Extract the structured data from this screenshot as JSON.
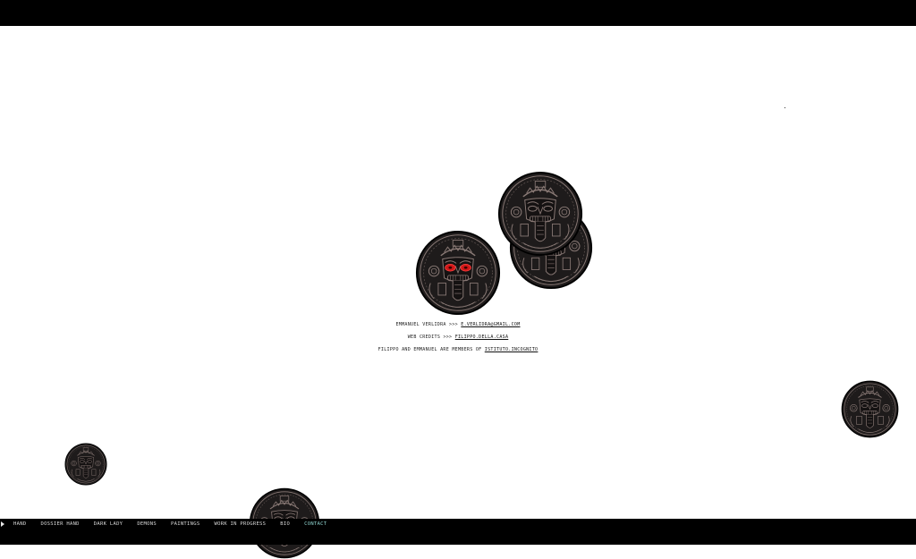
{
  "nav": {
    "items": [
      "HAND",
      "DOSSIER HAND",
      "DARK LADY",
      "DEMONS",
      "PAINTINGS",
      "WORK IN PROGRESS",
      "BIO",
      "CONTACT"
    ],
    "active": "CONTACT"
  },
  "contact": {
    "line1_label": "EMMANUEL VERLIDRA >>>",
    "line1_link": "E.VERLIDRA@GMAIL.COM",
    "line2_label": "WEB CREDITS >>>",
    "line2_link": "FILIPPO.DELLA.CASA",
    "line3_label": "FILIPPO AND EMMANUEL ARE MEMBERS OF",
    "line3_link": "ISTITUTO.INCOGNITO"
  },
  "colors": {
    "bars": "#000000",
    "medallion_fill": "#1e1b1b",
    "medallion_line": "#8a7a76",
    "eyes": "#d01818",
    "active_nav": "#8fd4cf"
  },
  "icons": [
    "play-icon",
    "aztec-medallion-icon"
  ]
}
